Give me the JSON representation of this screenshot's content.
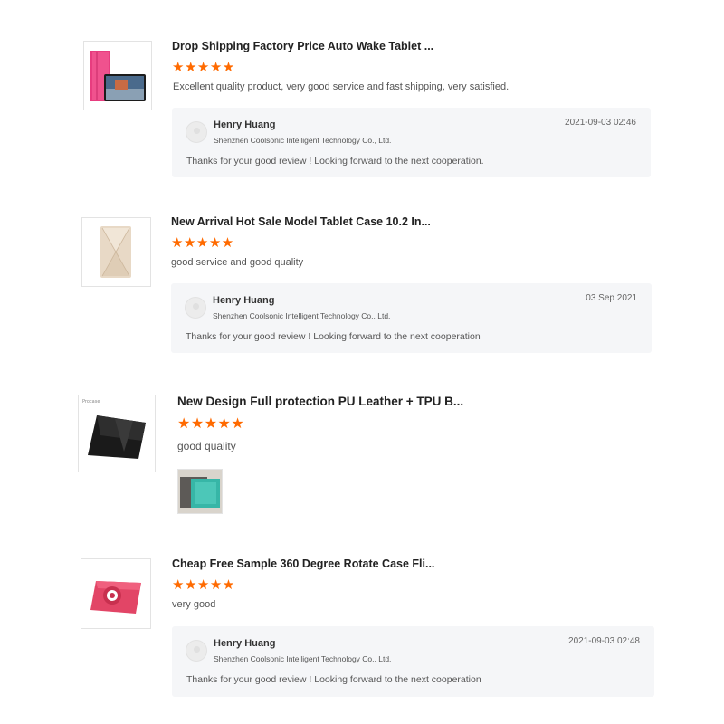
{
  "reviews": [
    {
      "product_title": "Drop Shipping Factory Price Auto Wake Tablet ...",
      "rating": 5,
      "stars": "★★★★★",
      "comment": "Excellent quality product, very good service and fast shipping, very satisfied.",
      "reply": {
        "name": "Henry Huang",
        "company": "Shenzhen Coolsonic Intelligent Technology Co., Ltd.",
        "date": "2021-09-03 02:46",
        "text": "Thanks for your good review ! Looking forward to the next cooperation."
      }
    },
    {
      "product_title": "New Arrival Hot Sale Model Tablet Case 10.2 In...",
      "rating": 5,
      "stars": "★★★★★",
      "comment": "good service and good quality",
      "reply": {
        "name": "Henry Huang",
        "company": "Shenzhen Coolsonic Intelligent Technology Co., Ltd.",
        "date": "03 Sep 2021",
        "text": "Thanks for your good review !  Looking forward to the next cooperation"
      }
    },
    {
      "product_title": "New Design Full protection PU Leather + TPU B...",
      "rating": 5,
      "stars": "★★★★★",
      "comment": "good quality"
    },
    {
      "product_title": "Cheap Free Sample 360 Degree Rotate Case Fli...",
      "rating": 5,
      "stars": "★★★★★",
      "comment": "very good",
      "reply": {
        "name": "Henry Huang",
        "company": "Shenzhen Coolsonic Intelligent Technology Co., Ltd.",
        "date": "2021-09-03 02:48",
        "text": "Thanks for your good review ! Looking forward to the next cooperation"
      }
    }
  ],
  "colors": {
    "star": "#ff6a00",
    "reply_bg": "#f5f6f8"
  }
}
